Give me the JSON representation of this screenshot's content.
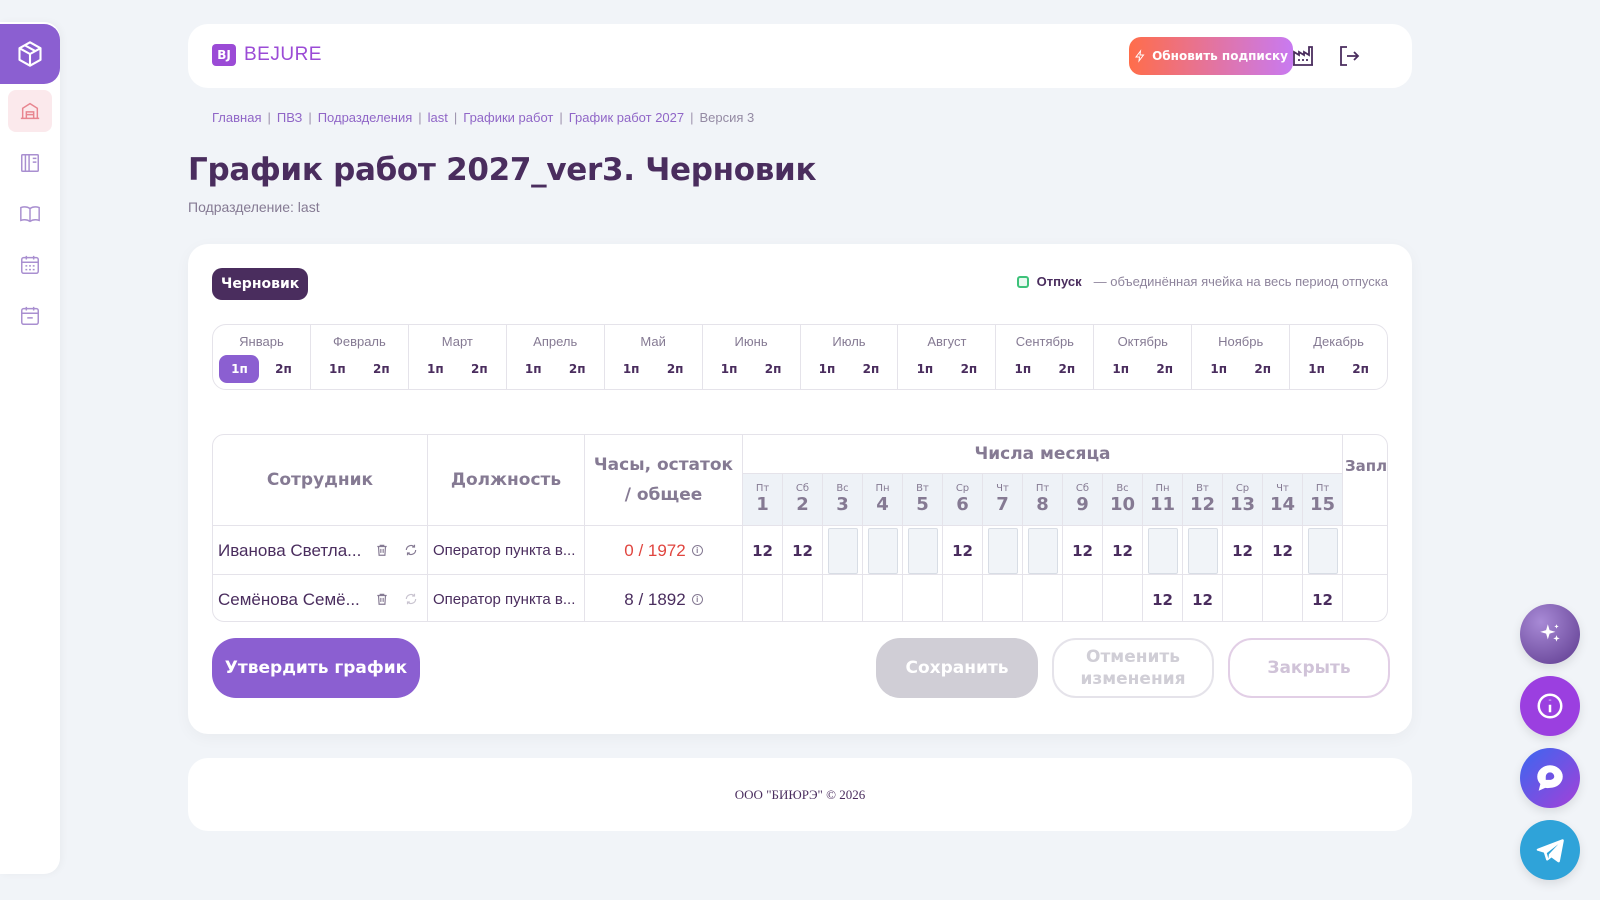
{
  "brand": {
    "badge": "BJ",
    "name": "BEJURE"
  },
  "header": {
    "upgrade_label": "Обновить подписку"
  },
  "breadcrumb": [
    "Главная",
    "ПВЗ",
    "Подразделения",
    "last",
    "Графики работ",
    "График работ 2027",
    "Версия 3"
  ],
  "page": {
    "title": "График работ 2027_ver3. Черновик",
    "subtitle": "Подразделение: last"
  },
  "status_badge": "Черновик",
  "legend": {
    "label": "Отпуск",
    "description": "— объединённая ячейка на весь период отпуска",
    "color": "#3ec27a"
  },
  "months": [
    {
      "name": "Январь",
      "halves": [
        "1п",
        "2п"
      ],
      "active": 0
    },
    {
      "name": "Февраль",
      "halves": [
        "1п",
        "2п"
      ]
    },
    {
      "name": "Март",
      "halves": [
        "1п",
        "2п"
      ]
    },
    {
      "name": "Апрель",
      "halves": [
        "1п",
        "2п"
      ]
    },
    {
      "name": "Май",
      "halves": [
        "1п",
        "2п"
      ]
    },
    {
      "name": "Июнь",
      "halves": [
        "1п",
        "2п"
      ]
    },
    {
      "name": "Июль",
      "halves": [
        "1п",
        "2п"
      ]
    },
    {
      "name": "Август",
      "halves": [
        "1п",
        "2п"
      ]
    },
    {
      "name": "Сентябрь",
      "halves": [
        "1п",
        "2п"
      ]
    },
    {
      "name": "Октябрь",
      "halves": [
        "1п",
        "2п"
      ]
    },
    {
      "name": "Ноябрь",
      "halves": [
        "1п",
        "2п"
      ]
    },
    {
      "name": "Декабрь",
      "halves": [
        "1п",
        "2п"
      ]
    }
  ],
  "table": {
    "headers": {
      "employee": "Сотрудник",
      "position": "Должность",
      "hours": "Часы, остаток / общее",
      "days_title": "Числа месяца",
      "salary": "Запл за п"
    },
    "days": [
      {
        "w": "Пт",
        "n": "1"
      },
      {
        "w": "Сб",
        "n": "2"
      },
      {
        "w": "Вс",
        "n": "3"
      },
      {
        "w": "Пн",
        "n": "4"
      },
      {
        "w": "Вт",
        "n": "5"
      },
      {
        "w": "Ср",
        "n": "6"
      },
      {
        "w": "Чт",
        "n": "7"
      },
      {
        "w": "Пт",
        "n": "8"
      },
      {
        "w": "Сб",
        "n": "9"
      },
      {
        "w": "Вс",
        "n": "10"
      },
      {
        "w": "Пн",
        "n": "11"
      },
      {
        "w": "Вт",
        "n": "12"
      },
      {
        "w": "Ср",
        "n": "13"
      },
      {
        "w": "Чт",
        "n": "14"
      },
      {
        "w": "Пт",
        "n": "15"
      }
    ],
    "rows": [
      {
        "name": "Иванова Светла...",
        "position": "Оператор пункта в...",
        "hours": "0 / 1972",
        "hours_state": "neg",
        "cells": [
          "12",
          "12",
          "box",
          "box",
          "box",
          "12",
          "box",
          "box",
          "12",
          "12",
          "box",
          "box",
          "12",
          "12",
          "box"
        ]
      },
      {
        "name": "Семёнова Семё...",
        "position": "Оператор пункта в...",
        "hours": "8 / 1892",
        "hours_state": "ok",
        "cells": [
          "",
          "",
          "",
          "",
          "",
          "",
          "",
          "",
          "",
          "",
          "12",
          "12",
          "",
          "",
          "12"
        ]
      }
    ]
  },
  "buttons": {
    "approve": "Утвердить график",
    "save": "Сохранить",
    "cancel": "Отменить изменения",
    "close": "Закрыть"
  },
  "footer": "ООО \"БИЮРЭ\" © 2026",
  "colors": {
    "accent": "#8b5fd1",
    "text": "#4a2d5e",
    "danger": "#e0453f"
  }
}
